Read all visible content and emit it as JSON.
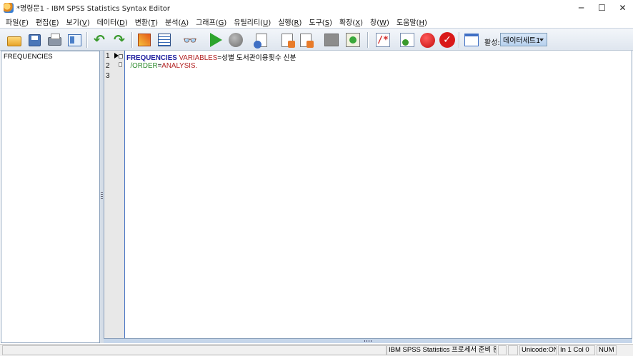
{
  "window": {
    "title": "*명령문1 - IBM SPSS Statistics Syntax Editor",
    "minimize": "─",
    "maximize": "☐",
    "close": "✕"
  },
  "menu": [
    {
      "label": "파일(",
      "key": "F",
      "end": ")"
    },
    {
      "label": "편집(",
      "key": "E",
      "end": ")"
    },
    {
      "label": "보기(",
      "key": "V",
      "end": ")"
    },
    {
      "label": "데이터(",
      "key": "D",
      "end": ")"
    },
    {
      "label": "변환(",
      "key": "T",
      "end": ")"
    },
    {
      "label": "분석(",
      "key": "A",
      "end": ")"
    },
    {
      "label": "그래프(",
      "key": "G",
      "end": ")"
    },
    {
      "label": "유틸리티(",
      "key": "U",
      "end": ")"
    },
    {
      "label": "실행(",
      "key": "R",
      "end": ")"
    },
    {
      "label": "도구(",
      "key": "S",
      "end": ")"
    },
    {
      "label": "확장(",
      "key": "X",
      "end": ")"
    },
    {
      "label": "창(",
      "key": "W",
      "end": ")"
    },
    {
      "label": "도움말(",
      "key": "H",
      "end": ")"
    }
  ],
  "toolbar": {
    "icons": [
      "folder-open-icon",
      "save-icon",
      "print-icon",
      "recall-dialog-icon",
      "undo-icon",
      "redo-icon",
      "goto-case-icon",
      "variables-icon",
      "find-icon",
      "run-icon",
      "stop-icon",
      "syntax-help-icon",
      "bookmark-icon",
      "next-bookmark-icon",
      "step-gray-icon",
      "step-green-icon",
      "comment-icon",
      "validate-icon",
      "breakpoint-icon",
      "check-syntax-icon",
      "show-lines-icon"
    ],
    "active_label": "활성:",
    "active_dataset": "데이터세트1"
  },
  "nav": {
    "items": [
      "FREQUENCIES"
    ]
  },
  "editor": {
    "line_numbers": [
      "1",
      "2",
      "3"
    ],
    "line1": {
      "command": "FREQUENCIES",
      "subcommand": "VARIABLES",
      "rest": "=성별 도서관이용횟수 신분"
    },
    "line2": {
      "slash_order": "/ORDER",
      "eq": "=",
      "value": "ANALYSIS."
    }
  },
  "status": {
    "processor": "IBM SPSS Statistics 프로세서 준비 완료",
    "unicode": "Unicode:ON",
    "position": "In 1 Col 0",
    "num": "NUM"
  }
}
